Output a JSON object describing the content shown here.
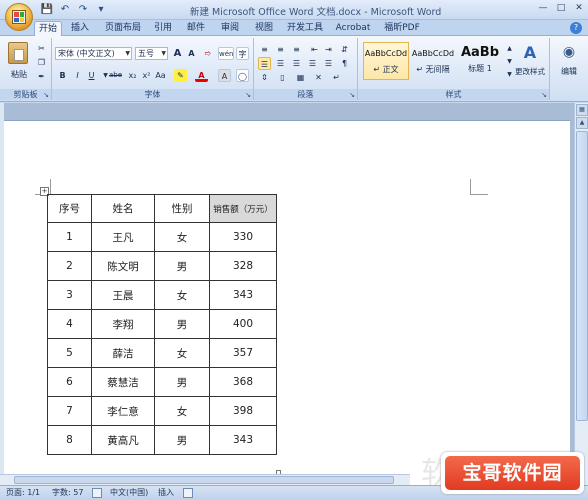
{
  "window": {
    "title": "新建 Microsoft Office Word 文档.docx - Microsoft Word",
    "controls": [
      "minimize",
      "maximize",
      "close"
    ]
  },
  "quick_access": [
    "save-icon",
    "undo-icon",
    "redo-icon",
    "customize-icon"
  ],
  "tabs": [
    {
      "label": "开始",
      "active": true
    },
    {
      "label": "插入"
    },
    {
      "label": "页面布局"
    },
    {
      "label": "引用"
    },
    {
      "label": "邮件"
    },
    {
      "label": "审阅"
    },
    {
      "label": "视图"
    },
    {
      "label": "开发工具"
    },
    {
      "label": "Acrobat"
    },
    {
      "label": "福昕PDF"
    }
  ],
  "ribbon": {
    "clipboard": {
      "label": "剪贴板",
      "paste": "粘贴"
    },
    "font": {
      "label": "字体",
      "font_name": "宋体 (中文正文)",
      "font_size": "五号",
      "grow": "A",
      "shrink": "A",
      "format_buttons": [
        "B",
        "I",
        "U",
        "abe",
        "x₂",
        "x²",
        "Aa"
      ],
      "wen": "wén",
      "char_border": "A",
      "enclose": "字"
    },
    "paragraph": {
      "label": "段落"
    },
    "styles": {
      "label": "样式",
      "items": [
        {
          "sample": "AaBbCcDd",
          "name": "↵ 正文",
          "active": true
        },
        {
          "sample": "AaBbCcDd",
          "name": "↵ 无间隔"
        },
        {
          "sample": "AaBb",
          "name": "标题 1"
        }
      ],
      "change": "更改样式"
    },
    "editing": {
      "label": "编辑"
    }
  },
  "table": {
    "headers": [
      "序号",
      "姓名",
      "性别",
      "销售额（万元）"
    ],
    "rows": [
      [
        "1",
        "王凡",
        "女",
        "330"
      ],
      [
        "2",
        "陈文明",
        "男",
        "328"
      ],
      [
        "3",
        "王晨",
        "女",
        "343"
      ],
      [
        "4",
        "李翔",
        "男",
        "400"
      ],
      [
        "5",
        "薛洁",
        "女",
        "357"
      ],
      [
        "6",
        "蔡慧洁",
        "男",
        "368"
      ],
      [
        "7",
        "李仁意",
        "女",
        "398"
      ],
      [
        "8",
        "黄高凡",
        "男",
        "343"
      ]
    ]
  },
  "watermark": "软件技巧",
  "status": {
    "page": "页面: 1/1",
    "words": "字数: 57",
    "language": "中文(中国)",
    "mode": "插入"
  },
  "logo": "宝哥软件园"
}
